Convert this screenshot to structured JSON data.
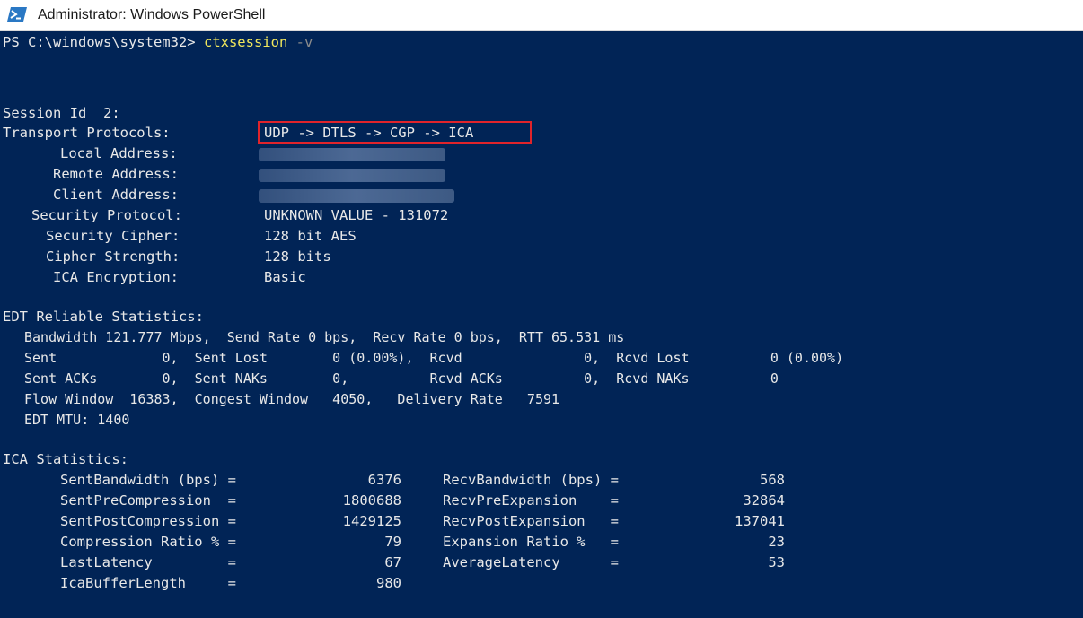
{
  "window": {
    "title": "Administrator: Windows PowerShell"
  },
  "prompt": {
    "path": "PS C:\\windows\\system32>",
    "command": "ctxsession",
    "flag": "-v"
  },
  "session": {
    "id_label": "Session Id  2:",
    "transport_label": "Transport Protocols:",
    "transport_value": "UDP -> DTLS -> CGP -> ICA",
    "local_label": "Local Address:",
    "remote_label": "Remote Address:",
    "client_label": "Client Address:",
    "security_label": "Security Protocol:",
    "security_value": "UNKNOWN VALUE - 131072",
    "cipher_label": "Security Cipher:",
    "cipher_value": "128 bit AES",
    "strength_label": "Cipher Strength:",
    "strength_value": "128 bits",
    "encryption_label": "ICA Encryption:",
    "encryption_value": "Basic"
  },
  "edt": {
    "header": "EDT Reliable Statistics:",
    "bandwidth_line": "Bandwidth 121.777 Mbps,  Send Rate 0 bps,  Recv Rate 0 bps,  RTT 65.531 ms",
    "sent_line": "Sent             0,  Sent Lost        0 (0.00%),  Rcvd               0,  Rcvd Lost          0 (0.00%)",
    "acks_line": "Sent ACKs        0,  Sent NAKs        0,          Rcvd ACKs          0,  Rcvd NAKs          0",
    "flow_line": "Flow Window  16383,  Congest Window   4050,   Delivery Rate   7591",
    "mtu_line": "EDT MTU: 1400"
  },
  "ica": {
    "header": "ICA Statistics:",
    "rows": [
      {
        "l_label": "SentBandwidth (bps) =",
        "l_value": "6376",
        "r_label": "RecvBandwidth (bps) =",
        "r_value": "568"
      },
      {
        "l_label": "SentPreCompression  =",
        "l_value": "1800688",
        "r_label": "RecvPreExpansion    =",
        "r_value": "32864"
      },
      {
        "l_label": "SentPostCompression =",
        "l_value": "1429125",
        "r_label": "RecvPostExpansion   =",
        "r_value": "137041"
      },
      {
        "l_label": "Compression Ratio % =",
        "l_value": "79",
        "r_label": "Expansion Ratio %   =",
        "r_value": "23"
      },
      {
        "l_label": "LastLatency         =",
        "l_value": "67",
        "r_label": "AverageLatency      =",
        "r_value": "53"
      },
      {
        "l_label": "IcaBufferLength     =",
        "l_value": "980",
        "r_label": "",
        "r_value": ""
      }
    ]
  },
  "colors": {
    "background": "#012456",
    "text": "#e8e8e8",
    "command": "#f2e85c",
    "highlight_box": "#e0242b"
  }
}
